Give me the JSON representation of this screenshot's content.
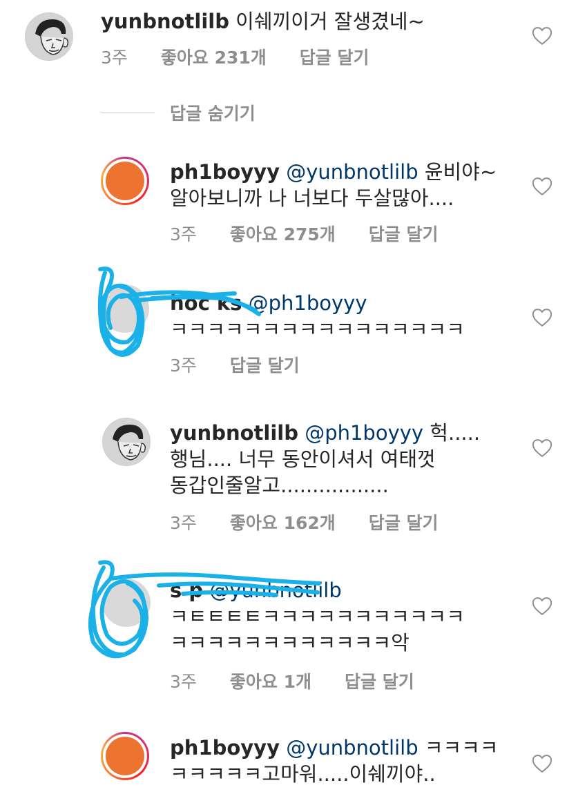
{
  "colors": {
    "text": "#262626",
    "meta": "#8e8e8e",
    "mention": "#00376b",
    "avatar_orange": "#ed7430",
    "scribble": "#1ab0e8"
  },
  "comments": [
    {
      "username": "yunbnotlilb",
      "text": " 이쉐끼이거 잘생겼네~",
      "time": "3주",
      "likes": "좋아요 231개",
      "reply": "답글 달기",
      "avatar": "sketch-avatar",
      "like_icon": "heart-outline-icon"
    },
    {
      "username": "ph1boyyy",
      "mention": "@yunbnotlilb",
      "text_line1": " 윤비야~",
      "text_line2": "알아보니까 나 너보다 두살많아....",
      "time": "3주",
      "likes": "좋아요 275개",
      "reply": "답글 달기",
      "avatar": "orange-story-avatar",
      "like_icon": "heart-outline-icon"
    },
    {
      "username": "hoc ks",
      "mention": "@ph1boyyy",
      "text_line2": "ㅋㅋㅋㅋㅋㅋㅋㅋㅋㅋㅋㅋㅋㅋㅋㅋ",
      "time": "3주",
      "reply": "답글 달기",
      "avatar": "scribbled-avatar",
      "like_icon": "heart-outline-icon"
    },
    {
      "username": "yunbnotlilb",
      "mention": "@ph1boyyy",
      "text_line1": " 헉.....",
      "text_line2": "행님.... 너무 동안이셔서 여태껏",
      "text_line3": "동갑인줄알고.................",
      "time": "3주",
      "likes": "좋아요 162개",
      "reply": "답글 달기",
      "avatar": "sketch-avatar",
      "like_icon": "heart-outline-icon"
    },
    {
      "username": "s p",
      "mention": "@yunbnotlilb",
      "text_line2": "ㅋㅌㅌㅌㅌㅋㅋㅋㅋㅋㅋㅋㅋㅋㅋㅋ",
      "text_line3": "ㅋㅋㅋㅋㅋㅋㅋㅋㅋㅋㅋㅋ악",
      "time": "3주",
      "likes": "좋아요 1개",
      "reply": "답글 달기",
      "avatar": "scribbled-avatar",
      "like_icon": "heart-outline-icon"
    },
    {
      "username": "ph1boyyy",
      "mention": "@yunbnotlilb",
      "text_line1": " ㅋㅋㅋㅋ",
      "text_line2": "ㅋㅋㅋㅋㅋ고마워.....이쉐끼야..",
      "avatar": "orange-story-avatar",
      "like_icon": "heart-outline-icon"
    }
  ],
  "hide_replies": "답글 숨기기"
}
